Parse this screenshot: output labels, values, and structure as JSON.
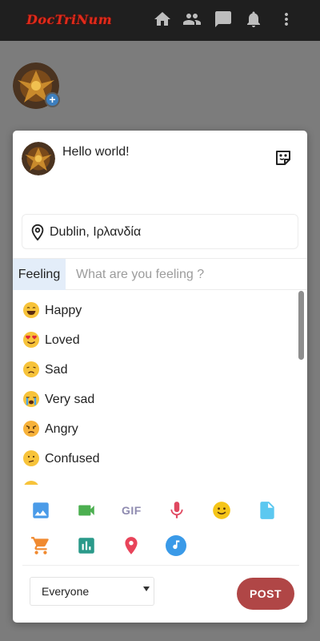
{
  "header": {
    "logo_text": "DocTriNum",
    "icons": [
      "home-icon",
      "people-icon",
      "chat-icon",
      "notifications-icon",
      "more-vert-icon"
    ]
  },
  "composer": {
    "post_text": "Hello world!",
    "location": "Dublin, Ιρλανδία",
    "feeling_label": "Feeling",
    "feeling_placeholder": "What are you feeling ?",
    "feelings": [
      {
        "label": "Happy",
        "icon": "happy-emoji-icon"
      },
      {
        "label": "Loved",
        "icon": "loved-emoji-icon"
      },
      {
        "label": "Sad",
        "icon": "sad-emoji-icon"
      },
      {
        "label": "Very sad",
        "icon": "very-sad-emoji-icon"
      },
      {
        "label": "Angry",
        "icon": "angry-emoji-icon"
      },
      {
        "label": "Confused",
        "icon": "confused-emoji-icon"
      }
    ],
    "gif_label": "GIF",
    "media_icons": [
      "image-icon",
      "video-icon",
      "gif-icon",
      "microphone-icon",
      "smiley-icon",
      "file-icon",
      "cart-icon",
      "poll-icon",
      "location-pin-icon",
      "music-icon"
    ],
    "privacy_value": "Everyone",
    "post_label": "POST"
  },
  "colors": {
    "topbar": "#1f1f1f",
    "logo": "#e02a1a",
    "post_button": "#b04646",
    "feeling_tag": "#e3edf9"
  }
}
